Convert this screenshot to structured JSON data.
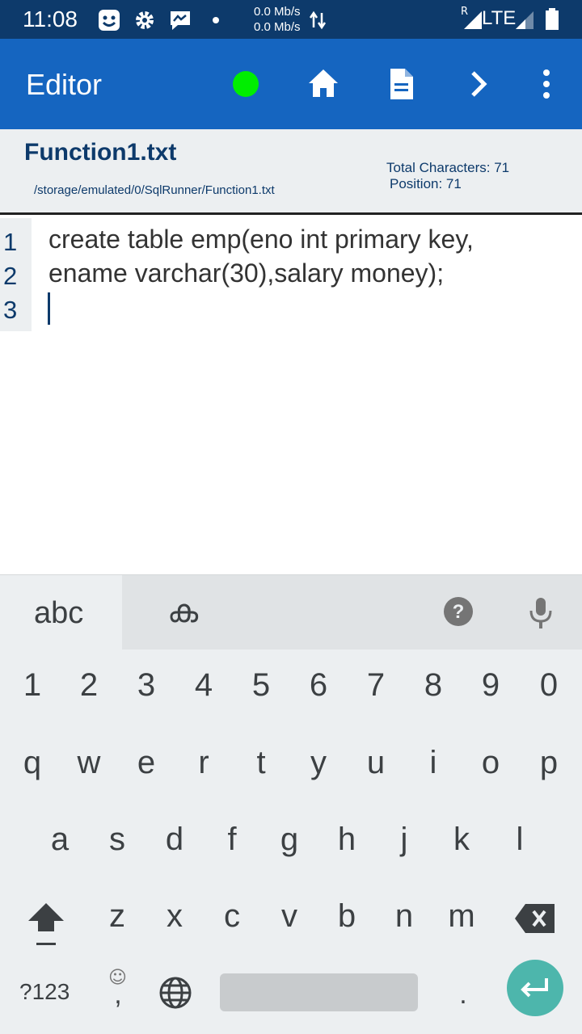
{
  "status_bar": {
    "time": "11:08",
    "net_up": "0.0 Mb/s",
    "net_down": "0.0 Mb/s",
    "roaming": "R",
    "network": "LTE",
    "icons": [
      "face-app-icon",
      "settings-icon",
      "messenger-icon",
      "notification-dot-icon",
      "data-arrows-icon",
      "signal-icon",
      "battery-icon"
    ]
  },
  "app_bar": {
    "title": "Editor",
    "status_color": "#00ee00",
    "actions": [
      "home-icon",
      "document-icon",
      "chevron-right-icon",
      "more-vert-icon"
    ]
  },
  "file": {
    "name": "Function1.txt",
    "path": "/storage/emulated/0/SqlRunner/Function1.txt",
    "total_chars": "Total Characters: 71",
    "position": "Position: 71"
  },
  "editor": {
    "line_numbers": [
      "1",
      "2",
      "3"
    ],
    "lines": [
      "create table emp(eno int primary key,",
      "ename varchar(30),salary money);",
      ""
    ]
  },
  "keyboard": {
    "tab_abc": "abc",
    "tab_lang": "ക",
    "numbers": [
      "1",
      "2",
      "3",
      "4",
      "5",
      "6",
      "7",
      "8",
      "9",
      "0"
    ],
    "row1": [
      "q",
      "w",
      "e",
      "r",
      "t",
      "y",
      "u",
      "i",
      "o",
      "p"
    ],
    "row2": [
      "a",
      "s",
      "d",
      "f",
      "g",
      "h",
      "j",
      "k",
      "l"
    ],
    "row3": [
      "z",
      "x",
      "c",
      "v",
      "b",
      "n",
      "m"
    ],
    "symbols_key": "?123",
    "comma_key": ",",
    "period_key": ".",
    "emoji_hint": "☺"
  },
  "colors": {
    "status_bar": "#0d3a6b",
    "app_bar": "#1565c0",
    "accent_text": "#0d3a6b",
    "enter_key": "#4db6ac"
  }
}
